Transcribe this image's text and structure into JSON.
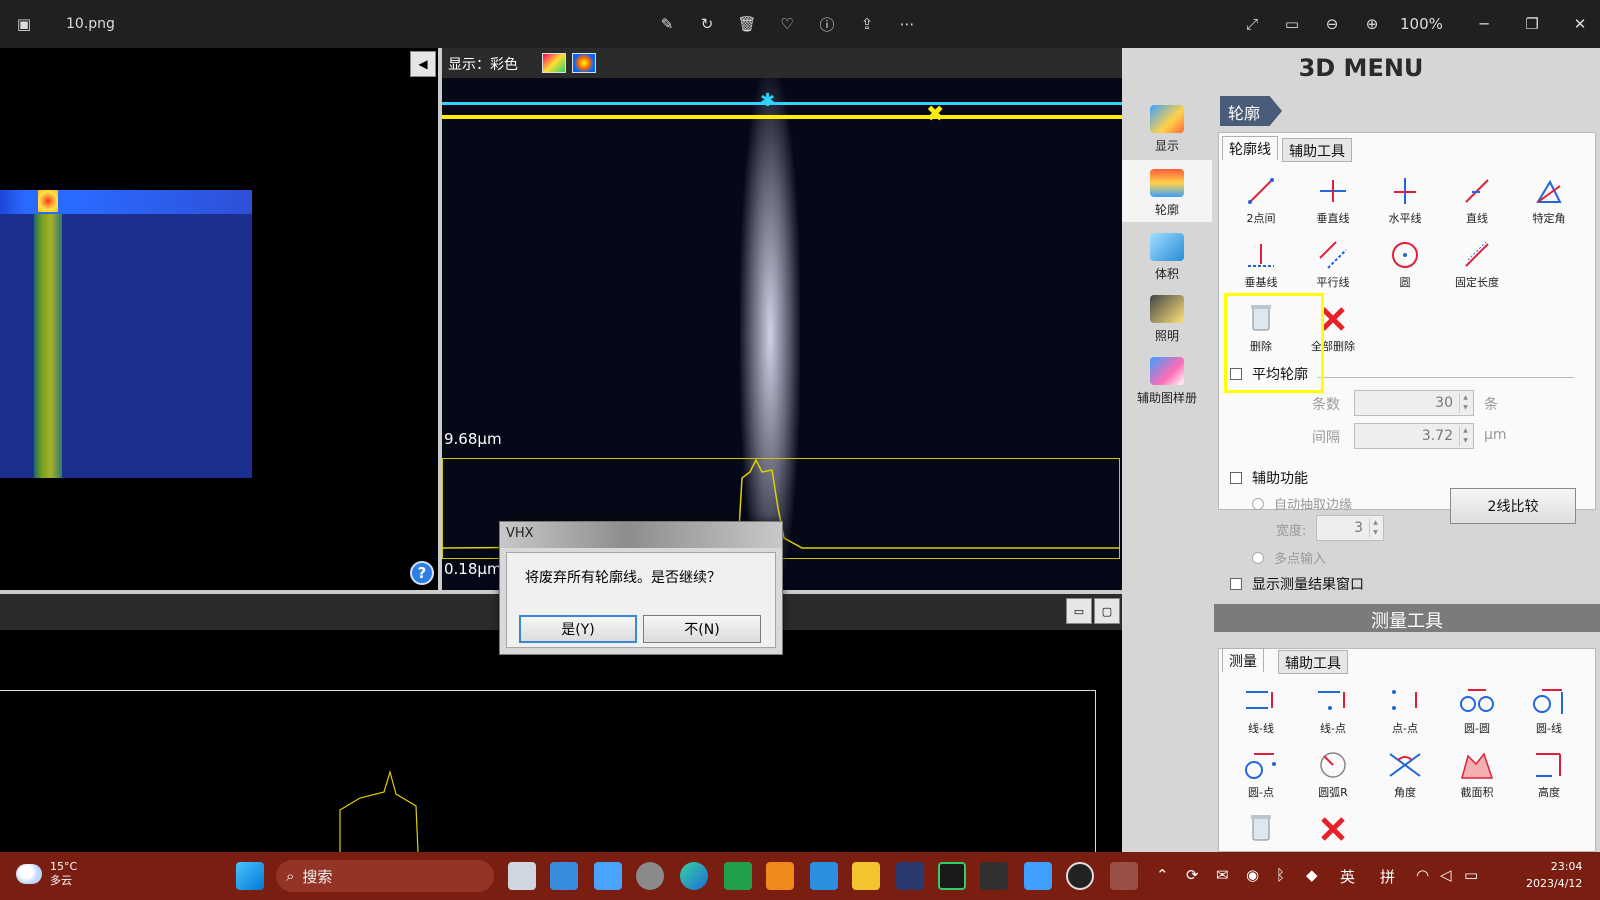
{
  "titlebar": {
    "filename": "10.png",
    "zoom": "100%",
    "icons": [
      "photo-app-icon",
      "edit-image-icon",
      "rotate-icon",
      "trash-icon",
      "favorite-icon",
      "info-icon",
      "share-icon",
      "more-icon",
      "fullscreen-icon",
      "fit-icon",
      "zoom-out-icon",
      "zoom-in-icon",
      "minimize-icon",
      "maximize-icon",
      "close-icon"
    ]
  },
  "viewer": {
    "display_label": "显示：彩色",
    "label_top": "9.68μm",
    "label_bottom": "0.18μm"
  },
  "dialog": {
    "title": "VHX",
    "message": "将废弃所有轮廓线。是否继续？",
    "yes_label": "是(Y)",
    "no_label": "不(N)"
  },
  "menu": {
    "title": "3D MENU",
    "nav": [
      {
        "label": "显示"
      },
      {
        "label": "轮廓"
      },
      {
        "label": "体积"
      },
      {
        "label": "照明"
      },
      {
        "label": "辅助图样册"
      }
    ],
    "contour_header": "轮廓",
    "contour_tabs": [
      "轮廓线",
      "辅助工具"
    ],
    "contour_tools": [
      "2点间",
      "垂直线",
      "水平线",
      "直线",
      "特定角",
      "垂基线",
      "平行线",
      "圆",
      "固定长度",
      "删除",
      "全部删除"
    ],
    "average_profile": "平均轮廓",
    "count_label": "条数",
    "count_value": "30",
    "count_unit": "条",
    "interval_label": "间隔",
    "interval_value": "3.72",
    "interval_unit": "μm",
    "aux_function": "辅助功能",
    "auto_edge": "自动抽取边缘",
    "width_label": "宽度:",
    "width_value": "3",
    "multi_point": "多点输入",
    "show_result": "显示测量结果窗口",
    "compare_button": "2线比较",
    "measure_header": "测量工具",
    "measure_tabs": [
      "测量",
      "辅助工具"
    ],
    "measure_tools": [
      "线-线",
      "线-点",
      "点-点",
      "圆-圆",
      "圆-线",
      "圆-点",
      "圆弧R",
      "角度",
      "截面积",
      "高度"
    ]
  },
  "taskbar": {
    "weather_temp": "15°C",
    "weather_desc": "多云",
    "search": "搜索",
    "ime_lang": "英",
    "ime_mode": "拼",
    "time": "23:04",
    "date": "2023/4/12"
  },
  "colors": {
    "cyan_line": "#2ed3ff",
    "yellow_line": "#ffee00",
    "highlight": "#ffff00",
    "taskbar": "#7a1e12"
  }
}
